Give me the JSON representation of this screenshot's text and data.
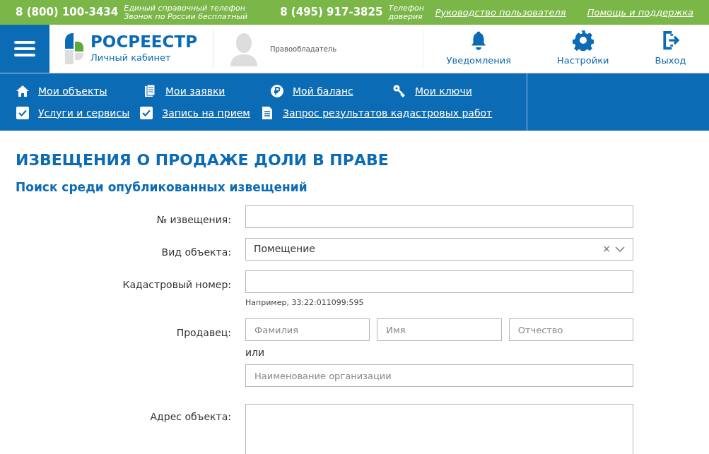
{
  "top_bar": {
    "phones": [
      {
        "number": "8 (800) 100-3434",
        "caption_lines": [
          "Единый справочный телефон",
          "Звонок по России бесплатный"
        ]
      },
      {
        "number": "8 (495) 917-3825",
        "caption_lines": [
          "Телефон",
          "доверия"
        ]
      }
    ],
    "links": [
      "Руководство пользователя",
      "Помощь и поддержка"
    ]
  },
  "header": {
    "logo": {
      "title": "РОСРЕЕСТР",
      "subtitle": "Личный кабинет"
    },
    "user_role": "Правообладатель",
    "actions": [
      {
        "kind": "bell",
        "label": "Уведомления"
      },
      {
        "kind": "gear",
        "label": "Настройки"
      },
      {
        "kind": "exit",
        "label": "Выход"
      }
    ]
  },
  "nav": {
    "rows": [
      [
        {
          "kind": "home",
          "label": "Мои объекты"
        },
        {
          "kind": "docs",
          "label": "Мои заявки"
        },
        {
          "kind": "ruble",
          "label": "Мой баланс"
        },
        {
          "kind": "key",
          "label": "Мои ключи"
        }
      ],
      [
        {
          "kind": "check",
          "label": "Услуги и сервисы"
        },
        {
          "kind": "check",
          "label": "Запись на прием"
        },
        {
          "kind": "doc",
          "label": "Запрос результатов кадастровых работ"
        }
      ]
    ]
  },
  "page": {
    "title": "ИЗВЕЩЕНИЯ О ПРОДАЖЕ ДОЛИ В ПРАВЕ",
    "subtitle": "Поиск среди опубликованных извещений",
    "form": [
      {
        "kind": "text",
        "label": "№ извещения:"
      },
      {
        "kind": "select",
        "label": "Вид объекта:",
        "value": "Помещение",
        "clear": "×"
      },
      {
        "kind": "text",
        "label": "Кадастровый номер:",
        "hint": "Например, 33:22:011099:595"
      },
      {
        "kind": "seller",
        "label": "Продавец:",
        "placeholders": [
          "Фамилия",
          "Имя",
          "Отчество"
        ],
        "separator": "или",
        "org_placeholder": "Наименование организации"
      },
      {
        "kind": "textarea",
        "label": "Адрес объекта:"
      }
    ]
  }
}
